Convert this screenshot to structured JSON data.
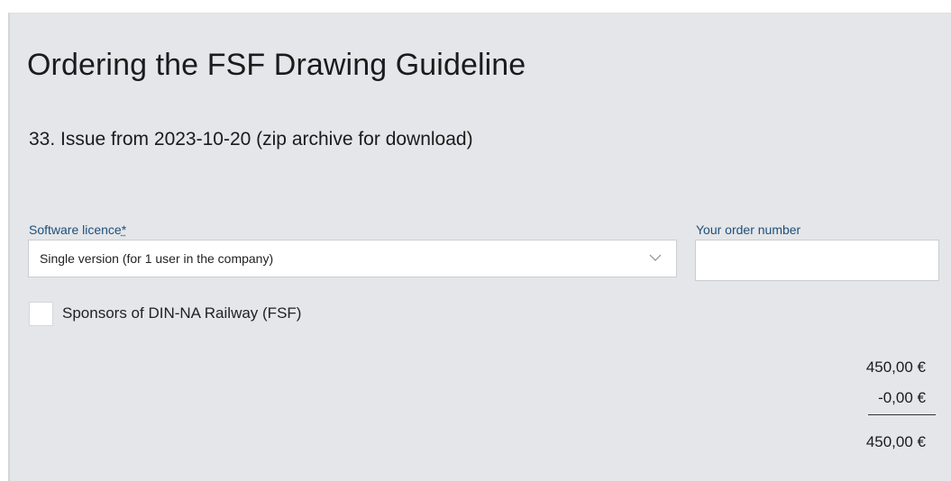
{
  "form": {
    "title": "Ordering the FSF Drawing Guideline",
    "subtitle": "33. Issue from 2023-10-20 (zip archive for download)",
    "licence": {
      "label": "Software licence",
      "required_marker": "*",
      "selected_value": "Single version (for 1 user in the company)",
      "icon": "chevron-down-icon"
    },
    "order_number": {
      "label": "Your order number",
      "value": "",
      "placeholder": ""
    },
    "sponsor": {
      "label": "Sponsors of DIN-NA Railway (FSF)",
      "checked": false
    },
    "pricing": {
      "subtotal": "450,00 €",
      "discount": "-0,00 €",
      "total": "450,00 €"
    }
  },
  "colors": {
    "panel_background": "#e4e6e9",
    "label_accent": "#1f4f7a",
    "text": "#1b1b1b"
  }
}
